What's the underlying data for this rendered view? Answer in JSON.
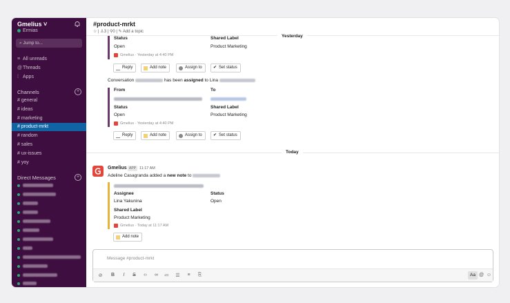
{
  "sidebar": {
    "workspace": "Gmelius",
    "user": "Ermias",
    "jump": "Jump to...",
    "nav": [
      "All unreads",
      "Threads",
      "Apps"
    ],
    "channels_heading": "Channels",
    "channels": [
      "general",
      "ideas",
      "marketing",
      "product-mrkt",
      "random",
      "sales",
      "ux-issues",
      "yoy"
    ],
    "dm_heading": "Direct Messages"
  },
  "channel": {
    "title": "#product-mrkt",
    "members": "3",
    "pins": "0",
    "add_topic": "Add a topic"
  },
  "feed": {
    "yesterday": "Yesterday",
    "today": "Today",
    "card1": {
      "status_label": "Status",
      "status_val": "Open",
      "shared_label": "Shared Label",
      "shared_val": "Product Marketing",
      "footer": "Gmelius · Yesterday at 4:40 PM"
    },
    "conv_prefix": "Conversation",
    "conv_mid": "has been",
    "conv_bold": "assigned",
    "conv_suffix": "to Lina",
    "card2": {
      "from_label": "From",
      "to_label": "To",
      "status_label": "Status",
      "status_val": "Open",
      "shared_label": "Shared Label",
      "shared_val": "Product Marketing",
      "footer": "Gmelius · Yesterday at 4:40 PM"
    },
    "buttons": {
      "reply": "Reply",
      "add_note": "Add note",
      "assign": "Assign to",
      "set_status": "Set status"
    },
    "msg3": {
      "sender": "Gmelius",
      "badge": "APP",
      "time": "11:17 AM",
      "text_prefix": "Adeline Casagranda added a",
      "text_bold": "new note",
      "text_suffix": "to",
      "assignee_label": "Assignee",
      "assignee_val": "Lina Yakunina",
      "status_label": "Status",
      "status_val": "Open",
      "shared_label": "Shared Label",
      "shared_val": "Product Marketing",
      "footer": "Gmelius · Today at 11:17 AM",
      "add_note": "Add note"
    }
  },
  "composer": {
    "placeholder": "Message #product-mrkt",
    "aa": "Aa"
  },
  "colors": {
    "sidebar": "#3f0e40",
    "active_channel": "#1164a3",
    "gmelius_red": "#e3453b"
  }
}
